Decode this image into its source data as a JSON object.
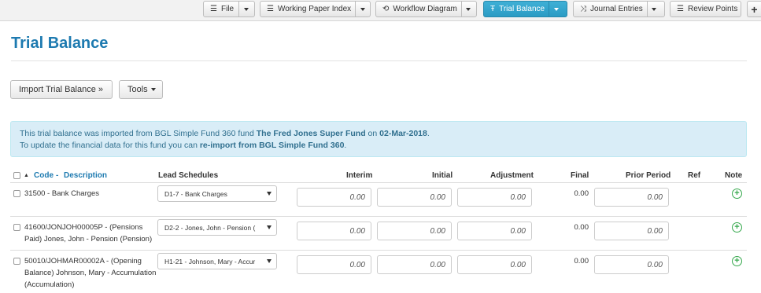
{
  "toolbar": {
    "file": "File",
    "working_paper_index": "Working Paper Index",
    "workflow_diagram": "Workflow Diagram",
    "trial_balance": "Trial Balance",
    "journal_entries": "Journal Entries",
    "review_points": "Review Points",
    "plus": "+"
  },
  "page": {
    "title": "Trial Balance"
  },
  "actions": {
    "import": "Import Trial Balance »",
    "tools": "Tools"
  },
  "info": {
    "line1_prefix": "This trial balance was imported from BGL Simple Fund 360 fund ",
    "fund_name": "The Fred Jones Super Fund",
    "line1_mid": " on ",
    "date": "02-Mar-2018",
    "line1_end": ".",
    "line2_prefix": "To update the financial data for this fund you can ",
    "reimport_link": "re-import from BGL Simple Fund 360",
    "line2_end": "."
  },
  "table": {
    "headers": {
      "code": "Code",
      "sep": "-",
      "description": "Description",
      "lead": "Lead Schedules",
      "interim": "Interim",
      "initial": "Initial",
      "adjustment": "Adjustment",
      "final": "Final",
      "prior": "Prior Period",
      "ref": "Ref",
      "note": "Note"
    },
    "rows": [
      {
        "account": "31500 - Bank Charges",
        "lead": "D1-7 - Bank Charges",
        "interim": "0.00",
        "initial": "0.00",
        "adjustment": "0.00",
        "final": "0.00",
        "prior": "0.00"
      },
      {
        "account": "41600/JONJOH00005P - (Pensions Paid) Jones, John - Pension (Pension)",
        "lead": "D2-2 - Jones, John - Pension (",
        "interim": "0.00",
        "initial": "0.00",
        "adjustment": "0.00",
        "final": "0.00",
        "prior": "0.00"
      },
      {
        "account": "50010/JOHMAR00002A - (Opening Balance) Johnson, Mary - Accumulation (Accumulation)",
        "lead": "H1-21 - Johnson, Mary - Accur",
        "interim": "0.00",
        "initial": "0.00",
        "adjustment": "0.00",
        "final": "0.00",
        "prior": "0.00"
      }
    ]
  },
  "colors": {
    "accent": "#1d7ab0",
    "active_tab": "#2a9bc4",
    "info_bg": "#d9edf7",
    "info_text": "#31708f",
    "add_icon": "#35a84c"
  },
  "icons": {
    "file": "list-icon",
    "working_paper_index": "list-icon",
    "workflow_diagram": "refresh-icon",
    "trial_balance": "text-height-icon",
    "journal_entries": "shuffle-icon",
    "review_points": "list-icon",
    "sort": "sort-asc-icon",
    "add_note": "plus-circle-icon"
  }
}
